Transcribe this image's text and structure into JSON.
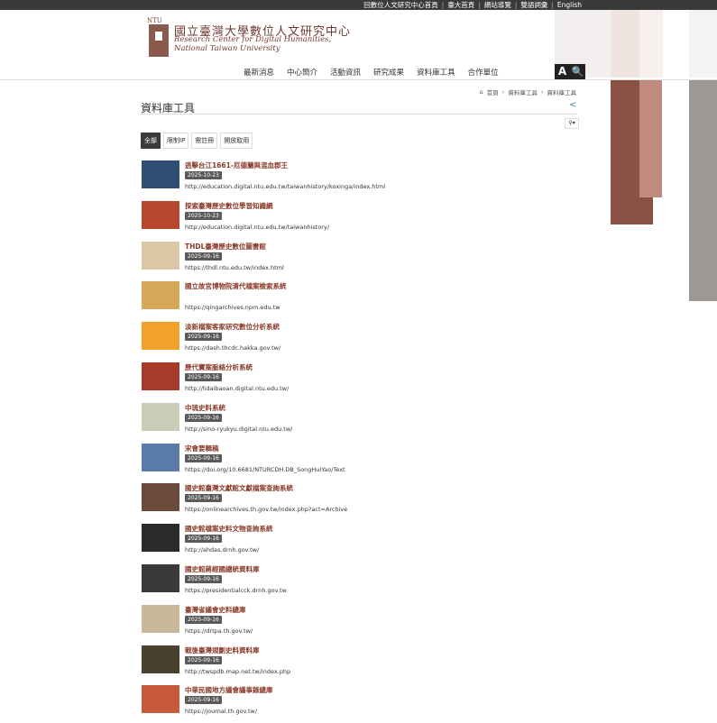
{
  "top_links": [
    "回數位人文研究中心首頁",
    "臺大首頁",
    "網站導覽",
    "雙語詞彙",
    "English"
  ],
  "logo": {
    "ntu": "NTU",
    "zh": "國立臺灣大學數位人文研究中心",
    "en_line1": "Research Center for Digital Humanities,",
    "en_line2": "National Taiwan University"
  },
  "nav": [
    "最新消息",
    "中心簡介",
    "活動資訊",
    "研究成果",
    "資料庫工具",
    "合作單位"
  ],
  "search_a": "A",
  "search_icon": "search-icon",
  "breadcrumb": [
    "首頁",
    "資料庫工具",
    "資料庫工具"
  ],
  "page_title": "資料庫工具",
  "filters": [
    "全部",
    "限制IP",
    "需註冊",
    "開放取用"
  ],
  "items": [
    {
      "title": "逃擊台江1661-厄德蘭與混血郡王",
      "date": "2025-10-23",
      "url": "http://education.digital.ntu.edu.tw/taiwanhistory/koxinga/index.html",
      "color": "#2e4f73"
    },
    {
      "title": "探索臺灣歷史數位學習知識網",
      "date": "2025-10-23",
      "url": "http://education.digital.ntu.edu.tw/taiwanhistory/",
      "color": "#b8472e"
    },
    {
      "title": "THDL臺灣歷史數位圖書館",
      "date": "2025-09-16",
      "url": "https://thdl.ntu.edu.tw/index.html",
      "color": "#d9c7a6"
    },
    {
      "title": "國立故宮博物院清代檔案檢索系統",
      "date": "",
      "url": "https://qingarchives.npm.edu.tw",
      "color": "#d6a85a"
    },
    {
      "title": "淡新檔案客家研究數位分析系統",
      "date": "2025-09-16",
      "url": "https://dash.thcdc.hakka.gov.tw/",
      "color": "#f2a12a"
    },
    {
      "title": "歷代寶案脈絡分析系統",
      "date": "2025-09-16",
      "url": "http://lidaibaoan.digital.ntu.edu.tw/",
      "color": "#a83a2a"
    },
    {
      "title": "中琉史料系統",
      "date": "2025-09-16",
      "url": "http://sino-ryukyu.digital.ntu.edu.tw/",
      "color": "#c9cdb8"
    },
    {
      "title": "宋會要輯稿",
      "date": "2025-09-16",
      "url": "https://doi.org/10.6681/NTURCDH.DB_SongHuiYao/Text",
      "color": "#5a7aa8"
    },
    {
      "title": "國史館臺灣文獻館文獻檔案查詢系統",
      "date": "2025-09-16",
      "url": "https://onlinearchives.th.gov.tw/index.php?act=Archive",
      "color": "#6b4a3a"
    },
    {
      "title": "國史館檔案史料文物查詢系統",
      "date": "2025-09-16",
      "url": "http://ahdas.drnh.gov.tw/",
      "color": "#2a2a2a"
    },
    {
      "title": "國史館蔣經國總統資料庫",
      "date": "2025-09-16",
      "url": "https://presidentialcck.drnh.gov.tw",
      "color": "#3a3a3a"
    },
    {
      "title": "臺灣省議會史料總庫",
      "date": "2025-09-16",
      "url": "https://drtpa.th.gov.tw/",
      "color": "#c9b89a"
    },
    {
      "title": "戰後臺灣規劃史料資料庫",
      "date": "2025-09-16",
      "url": "http://twspdb.map.net.tw/index.php",
      "color": "#4a4030"
    },
    {
      "title": "中華民國地方議會議事錄總庫",
      "date": "2025-09-16",
      "url": "https://journal.th.gov.tw/",
      "color": "#c65a3a"
    }
  ]
}
